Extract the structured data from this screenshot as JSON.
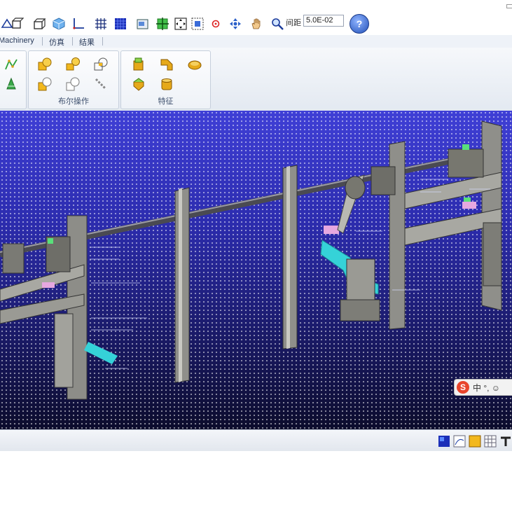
{
  "toolbar": {
    "icons": [
      "fit-all-icon",
      "zoom-area-icon",
      "pan-view-icon",
      "iso-view-icon",
      "axis-icon",
      "grid-icon",
      "render-mode-icon",
      "snapshot-icon",
      "normal-view-icon",
      "select-box-icon",
      "zoom-fit-icon",
      "target-icon",
      "rotate-icon",
      "hand-pan-icon",
      "zoom-icon"
    ],
    "spacing_label": "间距",
    "spacing_value": "5.0E-02",
    "help_glyph": "?"
  },
  "tabs": [
    {
      "label": "Machinery"
    },
    {
      "label": "仿真"
    },
    {
      "label": "结果"
    }
  ],
  "ribbon": {
    "boolean_group_label": "布尔操作",
    "feature_group_label": "特征"
  },
  "ime": {
    "logo": "S",
    "text": "中 °, ☺"
  },
  "statusbar": {
    "icons": [
      "color-mode-icon",
      "curve-plot-icon",
      "yellow-material-icon",
      "table-icon",
      "arrow-icon"
    ]
  },
  "colors": {
    "viewport_top": "#3f3fd6",
    "viewport_bottom": "#0c0c2c",
    "beam": "#8a8a88",
    "cyan_part": "#35d2d8",
    "green_part": "#59e07a",
    "pink_part": "#e6a8e0"
  }
}
